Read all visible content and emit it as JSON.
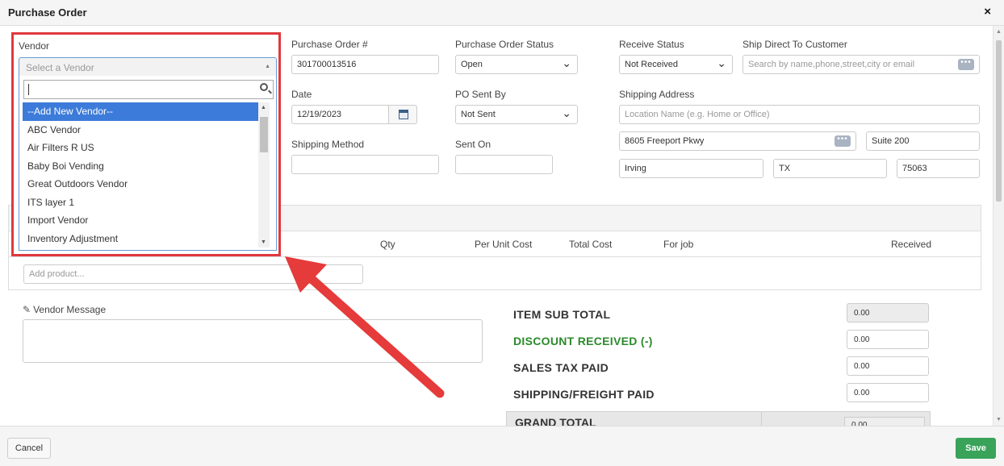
{
  "dialog": {
    "title": "Purchase Order",
    "close": "×"
  },
  "vendor": {
    "label": "Vendor",
    "placeholder": "Select a Vendor",
    "options": [
      "--Add New Vendor--",
      "ABC Vendor",
      "Air Filters R US",
      "Baby Boi Vending",
      "Great Outdoors Vendor",
      "ITS layer 1",
      "Import Vendor",
      "Inventory Adjustment"
    ],
    "selected_index": 0
  },
  "po_number": {
    "label": "Purchase Order #",
    "value": "301700013516"
  },
  "po_status": {
    "label": "Purchase Order Status",
    "value": "Open"
  },
  "receive_status": {
    "label": "Receive Status",
    "value": "Not Received"
  },
  "ship_direct": {
    "label": "Ship Direct To Customer",
    "placeholder": "Search by name,phone,street,city or email"
  },
  "date": {
    "label": "Date",
    "value": "12/19/2023"
  },
  "po_sent_by": {
    "label": "PO Sent By",
    "value": "Not Sent"
  },
  "shipping_address": {
    "label": "Shipping Address",
    "location_placeholder": "Location Name (e.g. Home or Office)",
    "street": "8605 Freeport Pkwy",
    "suite": "Suite 200",
    "city": "Irving",
    "state": "TX",
    "zip": "75063"
  },
  "shipping_method": {
    "label": "Shipping Method",
    "value": ""
  },
  "sent_on": {
    "label": "Sent On",
    "value": ""
  },
  "table": {
    "columns": {
      "qty": "Qty",
      "per_unit_cost": "Per Unit Cost",
      "total_cost": "Total Cost",
      "for_job": "For job",
      "received": "Received"
    },
    "add_product_placeholder": "Add product..."
  },
  "vendor_message": {
    "label": "Vendor Message",
    "value": ""
  },
  "totals": {
    "item_sub_total": {
      "label": "ITEM SUB TOTAL",
      "value": "0.00"
    },
    "discount_received": {
      "label": "DISCOUNT RECEIVED (-)",
      "value": "0.00"
    },
    "sales_tax_paid": {
      "label": "SALES TAX PAID",
      "value": "0.00"
    },
    "shipping_freight_paid": {
      "label": "SHIPPING/FREIGHT PAID",
      "value": "0.00"
    },
    "grand_total": {
      "label": "GRAND TOTAL",
      "value": "0.00"
    }
  },
  "footer": {
    "cancel": "Cancel",
    "save": "Save"
  },
  "colors": {
    "highlight_border": "#e0383e",
    "selected_option": "#3c7bd9",
    "save_button": "#3aa35a",
    "discount_label": "#2b8a2b"
  }
}
